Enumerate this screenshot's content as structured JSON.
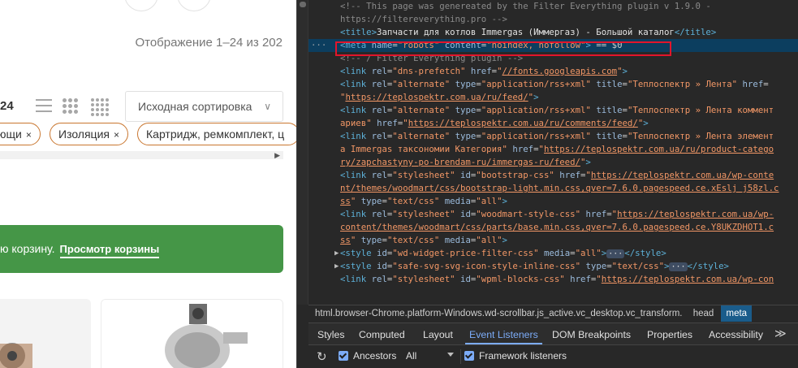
{
  "page": {
    "result_count": "Отображение 1–24 из 202",
    "per_page_value": "24",
    "sort_selected": "Исходная сортировка",
    "sort_chevron": "∨",
    "filter_chips": [
      {
        "label": "ющи",
        "remove": "×"
      },
      {
        "label": "Изоляция",
        "remove": "×"
      },
      {
        "label": "Картридж, ремкомплект, ц",
        "remove": ""
      }
    ],
    "chip_scroll_arrow": "▶",
    "cart_notice": {
      "text": "ю корзину.",
      "link": "Просмотр корзины"
    }
  },
  "devtools": {
    "code_lines": [
      {
        "type": "comment",
        "text": "<!-- This page was genereated by the Filter Everything plugin v 1.9.0 -"
      },
      {
        "type": "comment",
        "text": "https://filtereverything.pro -->"
      },
      {
        "type": "title",
        "text": "Запчасти для котлов Immergas (Иммергаз) - Большой каталог"
      },
      {
        "type": "meta",
        "name": "robots",
        "content": "noindex, nofollow",
        "suffix": "== $0"
      },
      {
        "type": "comment",
        "text": "<!-- / Filter Everything plugin -->"
      },
      {
        "type": "link",
        "rel": "dns-prefetch",
        "href": "//fonts.googleapis.com"
      },
      {
        "type": "link-alt",
        "line1_title": "Теплоспектр » Лента",
        "line2_href": "https://teplospektr.com.ua/ru/feed/"
      },
      {
        "type": "link-alt",
        "line1_title": "Теплоспектр » Лента коммент",
        "line2_title": "ариев",
        "line2_href": "https://teplospektr.com.ua/ru/comments/feed/"
      },
      {
        "type": "link-alt",
        "line1_title": "Теплоспектр » Лента элемент",
        "line2_title": "а Immergas таксономии Категория",
        "line2_href": "https://teplospektr.com.ua/ru/product-catego",
        "line3_href": "ry/zapchastyny-po-brendam-ru/immergas-ru/feed/"
      },
      {
        "type": "stylesheet",
        "id": "bootstrap-css",
        "href1": "https://teplospektr.com.ua/wp-conte",
        "href2": "nt/themes/woodmart/css/bootstrap-light.min.css,qver=7.6.0.pagespeed.ce.xEslj j58zl.c",
        "href3": "ss"
      },
      {
        "type": "stylesheet",
        "id": "woodmart-style-css",
        "href1": "https://teplospektr.com.ua/wp-",
        "href2": "content/themes/woodmart/css/parts/base.min.css,qver=7.6.0.pagespeed.ce.Y8UKZDHOT1.c",
        "href3": "ss"
      },
      {
        "type": "style",
        "id": "wd-widget-price-filter-css",
        "media": "all"
      },
      {
        "type": "style",
        "id": "safe-svg-svg-icon-style-inline-css",
        "attr": "type",
        "value": "text/css"
      },
      {
        "type": "stylesheet-cut",
        "id": "wpml-blocks-css",
        "href1": "https://teplospektr.com.ua/wp-con"
      }
    ],
    "breadcrumbs": [
      "html.browser-Chrome.platform-Windows.wd-scrollbar.js_active.vc_desktop.vc_transform.",
      "head",
      "meta"
    ],
    "panel_tabs": [
      "Styles",
      "Computed",
      "Layout",
      "Event Listeners",
      "DOM Breakpoints",
      "Properties",
      "Accessibility"
    ],
    "active_tab": "Event Listeners",
    "more_tabs": "≫",
    "toolbar": {
      "refresh_icon": "↻",
      "ancestors_label": "Ancestors",
      "filter_value": "All",
      "framework_label": "Framework listeners"
    }
  }
}
